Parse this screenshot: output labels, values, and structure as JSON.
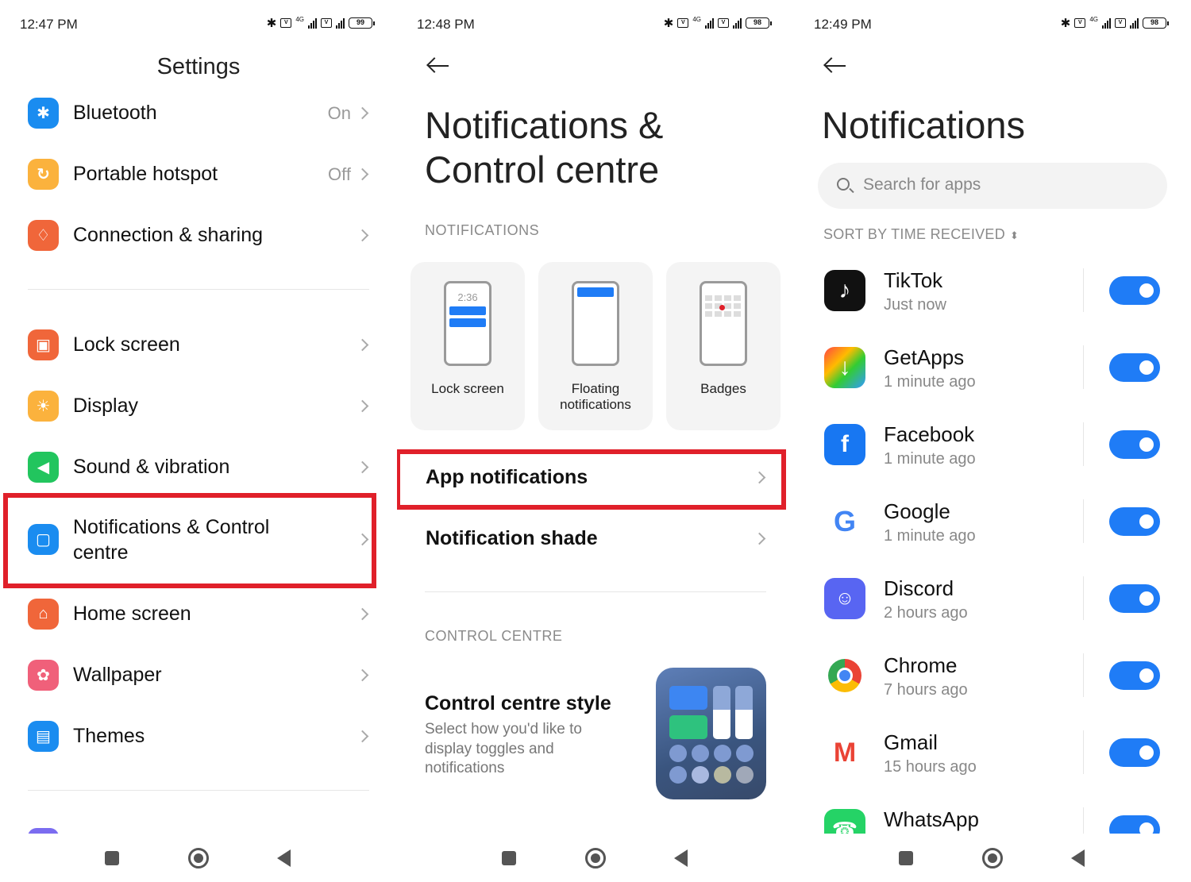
{
  "panel1": {
    "status": {
      "time": "12:47 PM",
      "net": "4G",
      "volte": "Vo LTE",
      "battery": "99"
    },
    "title": "Settings",
    "items": [
      {
        "label": "Bluetooth",
        "value": "On",
        "icon": "bluetooth-icon",
        "color": "#1a8cf0"
      },
      {
        "label": "Portable hotspot",
        "value": "Off",
        "icon": "hotspot-icon",
        "color": "#fbb23d"
      },
      {
        "label": "Connection & sharing",
        "value": "",
        "icon": "connection-sharing-icon",
        "color": "#f0663a"
      },
      {
        "label": "Lock screen",
        "value": "",
        "icon": "lock-icon",
        "color": "#f0663a"
      },
      {
        "label": "Display",
        "value": "",
        "icon": "sun-icon",
        "color": "#fbb23d"
      },
      {
        "label": "Sound & vibration",
        "value": "",
        "icon": "speaker-icon",
        "color": "#22c55e"
      },
      {
        "label": "Notifications & Control",
        "label2": "centre",
        "value": "",
        "icon": "notifications-icon",
        "color": "#1a8cf0"
      },
      {
        "label": "Home screen",
        "value": "",
        "icon": "home-icon",
        "color": "#f0663a"
      },
      {
        "label": "Wallpaper",
        "value": "",
        "icon": "wallpaper-flower-icon",
        "color": "#f0607a"
      },
      {
        "label": "Themes",
        "value": "",
        "icon": "themes-icon",
        "color": "#1a8cf0"
      }
    ]
  },
  "panel2": {
    "status": {
      "time": "12:48 PM",
      "net": "4G",
      "volte": "Vo LTE",
      "battery": "98"
    },
    "title_line1": "Notifications &",
    "title_line2": "Control centre",
    "notifications_label": "NOTIFICATIONS",
    "cards": [
      {
        "caption": "Lock screen",
        "time": "2:36"
      },
      {
        "caption": "Floating",
        "caption2": "notifications"
      },
      {
        "caption": "Badges"
      }
    ],
    "rows": [
      {
        "label": "App notifications"
      },
      {
        "label": "Notification shade"
      }
    ],
    "control_centre_label": "CONTROL CENTRE",
    "cc_style_title": "Control centre style",
    "cc_style_desc": "Select how you'd like to display toggles and notifications"
  },
  "panel3": {
    "status": {
      "time": "12:49 PM",
      "net": "4G",
      "volte": "Vo LTE",
      "battery": "98"
    },
    "title": "Notifications",
    "search_placeholder": "Search for apps",
    "sort_label": "SORT BY TIME RECEIVED",
    "apps": [
      {
        "name": "TikTok",
        "time": "Just now",
        "enabled": true,
        "icon": "tiktok-icon"
      },
      {
        "name": "GetApps",
        "time": "1 minute ago",
        "enabled": true,
        "icon": "getapps-icon"
      },
      {
        "name": "Facebook",
        "time": "1 minute ago",
        "enabled": true,
        "icon": "facebook-icon"
      },
      {
        "name": "Google",
        "time": "1 minute ago",
        "enabled": true,
        "icon": "google-icon"
      },
      {
        "name": "Discord",
        "time": "2 hours ago",
        "enabled": true,
        "icon": "discord-icon"
      },
      {
        "name": "Chrome",
        "time": "7 hours ago",
        "enabled": true,
        "icon": "chrome-icon"
      },
      {
        "name": "Gmail",
        "time": "15 hours ago",
        "enabled": true,
        "icon": "gmail-icon"
      },
      {
        "name": "WhatsApp",
        "time": "",
        "enabled": true,
        "icon": "whatsapp-icon"
      }
    ]
  },
  "colors": {
    "accent": "#1f7cf6",
    "highlight": "#e0202a"
  }
}
